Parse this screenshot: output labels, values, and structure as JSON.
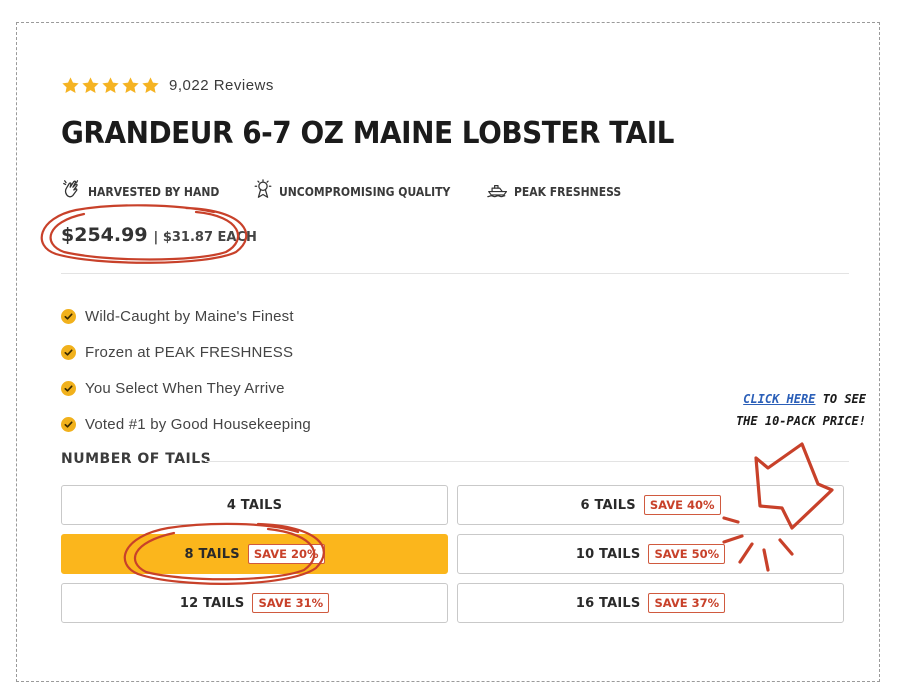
{
  "rating": {
    "stars": 5,
    "review_count": "9,022 Reviews"
  },
  "product": {
    "title": "GRANDEUR 6-7 OZ MAINE LOBSTER TAIL"
  },
  "badges": [
    {
      "icon": "hand-wave-icon",
      "label": "HARVESTED BY HAND"
    },
    {
      "icon": "medal-icon",
      "label": "UNCOMPROMISING QUALITY"
    },
    {
      "icon": "boat-icon",
      "label": "PEAK FRESHNESS"
    }
  ],
  "price": {
    "total": "$254.99",
    "each": "| $31.87 EACH"
  },
  "features": [
    "Wild-Caught by Maine's Finest",
    "Frozen at PEAK FRESHNESS",
    "You Select When They Arrive",
    "Voted #1 by Good Housekeeping"
  ],
  "tail_section": {
    "label": "NUMBER OF TAILS"
  },
  "options": [
    {
      "label": "4 TAILS",
      "save": ""
    },
    {
      "label": "6 TAILS",
      "save": "SAVE 40%"
    },
    {
      "label": "8 TAILS",
      "save": "SAVE 20%"
    },
    {
      "label": "10 TAILS",
      "save": "SAVE 50%"
    },
    {
      "label": "12 TAILS",
      "save": "SAVE 31%"
    },
    {
      "label": "16 TAILS",
      "save": "SAVE 37%"
    }
  ],
  "selected_option": "8 TAILS",
  "callout": {
    "link": "CLICK HERE",
    "line1_rest": " TO SEE",
    "line2": "THE 10-PACK PRICE!"
  },
  "colors": {
    "accent": "#fbb61c",
    "annotation_red": "#c8412a",
    "link_blue": "#2b5fb8",
    "star": "#f5b323"
  }
}
